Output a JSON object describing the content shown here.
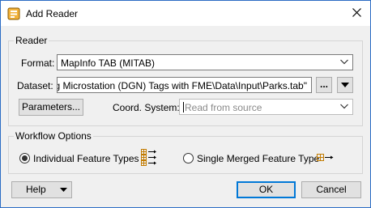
{
  "window": {
    "title": "Add Reader",
    "close_icon": "close-icon"
  },
  "reader": {
    "group_label": "Reader",
    "format_label": "Format:",
    "format_value": "MapInfo TAB (MITAB)",
    "dataset_label": "Dataset:",
    "dataset_value": "Writing Microstation (DGN) Tags with FME\\Data\\Input\\Parks.tab\"",
    "browse_label": "...",
    "parameters_label": "Parameters...",
    "coord_label": "Coord. System:",
    "coord_placeholder": "Read from source"
  },
  "workflow": {
    "group_label": "Workflow Options",
    "options": [
      {
        "label": "Individual Feature Types",
        "selected": true,
        "icon": "individual-feature-types-icon"
      },
      {
        "label": "Single Merged Feature Type",
        "selected": false,
        "icon": "single-merged-feature-type-icon"
      }
    ]
  },
  "footer": {
    "help_label": "Help",
    "ok_label": "OK",
    "cancel_label": "Cancel"
  },
  "colors": {
    "accent": "#0078d7",
    "feature_icon": "#c27b00",
    "window_border": "#2b6cc4"
  }
}
